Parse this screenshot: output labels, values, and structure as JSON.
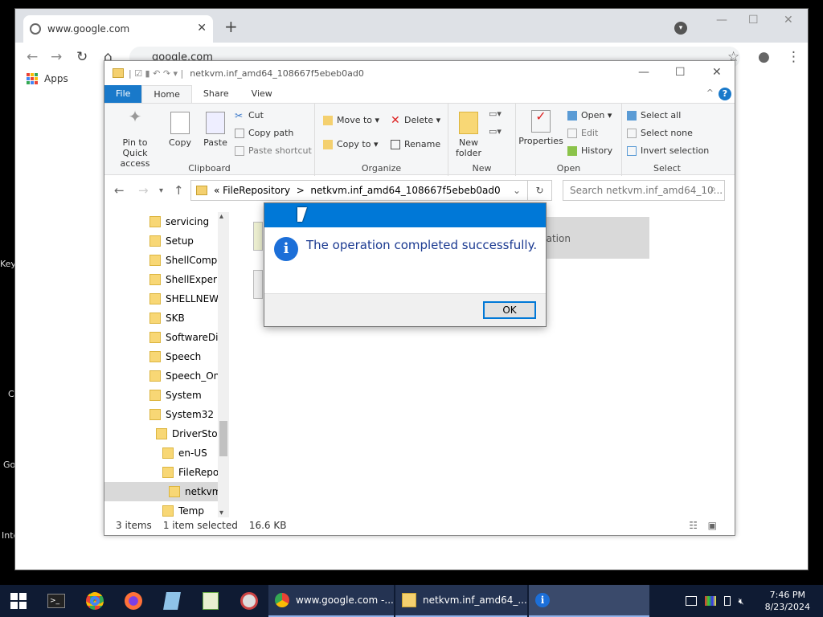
{
  "desktop": {
    "clip_labels": [
      "Key",
      "C",
      "Go",
      "Inte"
    ]
  },
  "chrome": {
    "tab_title": "www.google.com",
    "tab_close": "✕",
    "new_tab": "+",
    "url": "google.com",
    "bookmarks_apps": "Apps"
  },
  "explorer": {
    "title": "netkvm.inf_amd64_108667f5ebeb0ad0",
    "tabs": {
      "file": "File",
      "home": "Home",
      "share": "Share",
      "view": "View"
    },
    "ribbon": {
      "clipboard": {
        "label": "Clipboard",
        "pin": "Pin to Quick access",
        "copy": "Copy",
        "paste": "Paste",
        "cut": "Cut",
        "copy_path": "Copy path",
        "paste_shortcut": "Paste shortcut"
      },
      "organize": {
        "label": "Organize",
        "move_to": "Move to",
        "copy_to": "Copy to",
        "delete": "Delete",
        "rename": "Rename"
      },
      "new": {
        "label": "New",
        "new_folder": "New folder"
      },
      "open": {
        "label": "Open",
        "properties": "Properties",
        "open": "Open",
        "edit": "Edit",
        "history": "History"
      },
      "select": {
        "label": "Select",
        "select_all": "Select all",
        "select_none": "Select none",
        "invert": "Invert selection"
      }
    },
    "address": {
      "prefix": "«",
      "crumb1": "FileRepository",
      "sep": ">",
      "crumb2": "netkvm.inf_amd64_108667f5ebeb0ad0"
    },
    "search_placeholder": "Search netkvm.inf_amd64_10...",
    "tree": [
      "servicing",
      "Setup",
      "ShellCompo",
      "ShellExperie",
      "SHELLNEW",
      "SKB",
      "SoftwareDis",
      "Speech",
      "Speech_One",
      "System",
      "System32",
      "DriverStore",
      "en-US",
      "FileRepo",
      "netkvm",
      "Temp"
    ],
    "content_partial": "nation",
    "status": {
      "items": "3 items",
      "selected": "1 item selected",
      "size": "16.6 KB"
    }
  },
  "dialog": {
    "message": "The operation completed successfully.",
    "ok": "OK",
    "info_glyph": "i"
  },
  "taskbar": {
    "task_chrome": "www.google.com -...",
    "task_explorer": "netkvm.inf_amd64_...",
    "clock_time": "7:46 PM",
    "clock_date": "8/23/2024"
  }
}
